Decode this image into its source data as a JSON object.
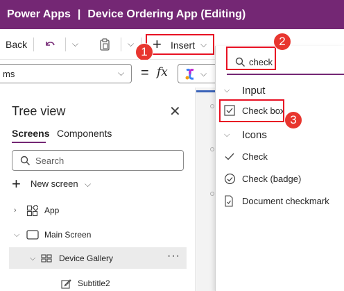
{
  "titlebar": {
    "app_name": "Power Apps",
    "separator": "|",
    "document": "Device Ordering App (Editing)"
  },
  "commandbar": {
    "back_label": "Back",
    "insert_label": "Insert"
  },
  "formulabar": {
    "property_value": "ms",
    "equals": "=",
    "fx": "fx"
  },
  "treeview": {
    "title": "Tree view",
    "tabs": [
      "Screens",
      "Components"
    ],
    "active_tab": "Screens",
    "search_placeholder": "Search",
    "new_screen_label": "New screen",
    "items": [
      {
        "label": "App",
        "icon": "app-icon"
      },
      {
        "label": "Main Screen",
        "icon": "screen-icon"
      },
      {
        "label": "Device Gallery",
        "icon": "gallery-icon"
      },
      {
        "label": "Subtitle2",
        "icon": "edit-text-icon"
      }
    ],
    "more_label": "···"
  },
  "insert_panel": {
    "search_value": "check",
    "sections": [
      {
        "title": "Input",
        "items": [
          {
            "label": "Check box",
            "icon": "checkbox-icon"
          }
        ]
      },
      {
        "title": "Icons",
        "items": [
          {
            "label": "Check",
            "icon": "check-icon"
          },
          {
            "label": "Check (badge)",
            "icon": "check-badge-icon"
          },
          {
            "label": "Document checkmark",
            "icon": "document-checkmark-icon"
          }
        ]
      }
    ]
  },
  "annotations": [
    "1",
    "2",
    "3"
  ],
  "colors": {
    "titlebar_bg": "#742774",
    "highlight_red": "#e81123",
    "badge_red": "#e8362f",
    "active_tab_underline": "#742774"
  }
}
